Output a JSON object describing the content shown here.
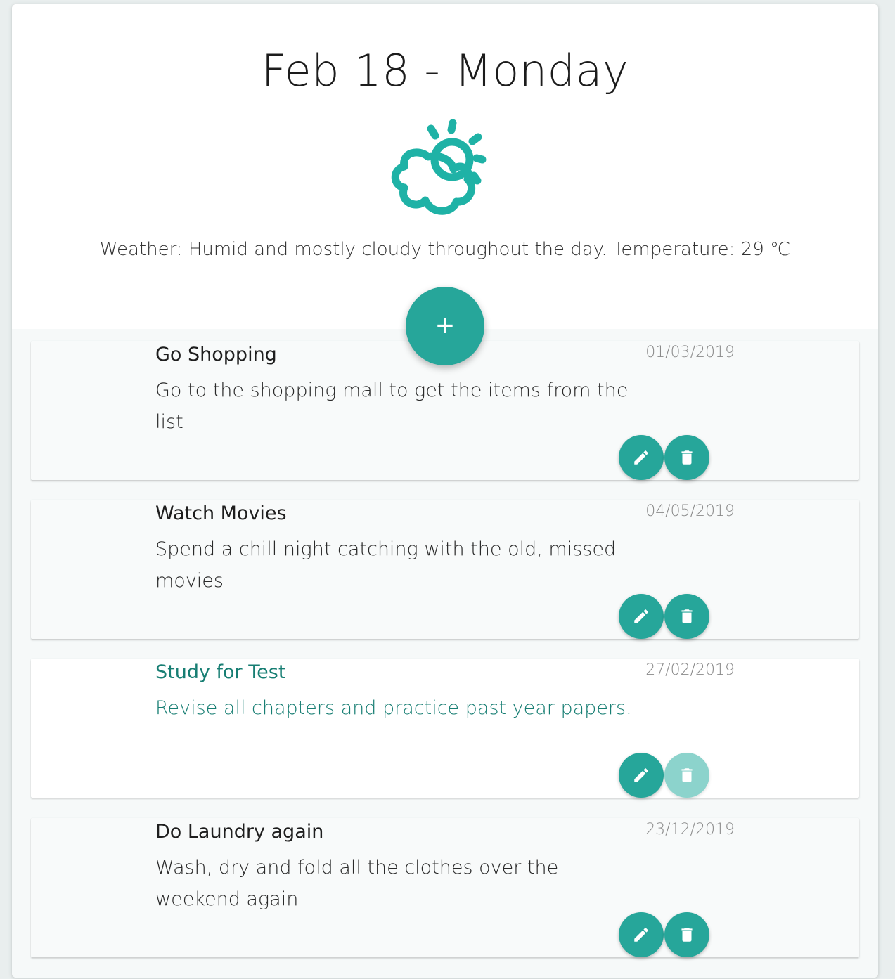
{
  "header": {
    "date_title": "Feb 18 - Monday",
    "weather_text": "Weather: Humid and mostly cloudy throughout the day. Temperature: 29 ℃",
    "weather_icon": "partly-cloudy-icon"
  },
  "add_button": {
    "label": "+"
  },
  "tasks": [
    {
      "title": "Go Shopping",
      "description": "Go to the shopping mall to get the items from the list",
      "date": "01/03/2019",
      "completed": false
    },
    {
      "title": "Watch Movies",
      "description": "Spend a chill night catching with the old, missed movies",
      "date": "04/05/2019",
      "completed": false
    },
    {
      "title": "Study for Test",
      "description": "Revise all chapters and practice past year papers.",
      "date": "27/02/2019",
      "completed": true
    },
    {
      "title": "Do Laundry again",
      "description": "Wash, dry and fold all the clothes over the weekend again",
      "date": "23/12/2019",
      "completed": false
    }
  ],
  "icons": {
    "edit": "pencil-icon",
    "delete": "trash-icon"
  },
  "colors": {
    "accent": "#26a69a",
    "accent_light": "#8cd3cc",
    "completed_text": "#177e73"
  }
}
